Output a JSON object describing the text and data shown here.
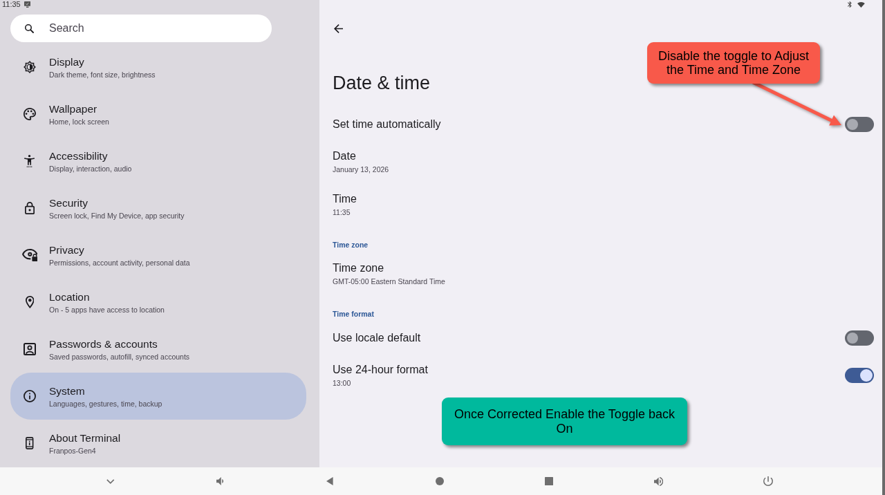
{
  "status_bar": {
    "time": "11:35"
  },
  "sidebar": {
    "search": {
      "placeholder": "Search"
    },
    "items": [
      {
        "title": "Display",
        "subtitle": "Dark theme, font size, brightness",
        "selected": false
      },
      {
        "title": "Wallpaper",
        "subtitle": "Home, lock screen",
        "selected": false
      },
      {
        "title": "Accessibility",
        "subtitle": "Display, interaction, audio",
        "selected": false
      },
      {
        "title": "Security",
        "subtitle": "Screen lock, Find My Device, app security",
        "selected": false
      },
      {
        "title": "Privacy",
        "subtitle": "Permissions, account activity, personal data",
        "selected": false
      },
      {
        "title": "Location",
        "subtitle": "On - 5 apps have access to location",
        "selected": false
      },
      {
        "title": "Passwords & accounts",
        "subtitle": "Saved passwords, autofill, synced accounts",
        "selected": false
      },
      {
        "title": "System",
        "subtitle": "Languages, gestures, time, backup",
        "selected": true
      },
      {
        "title": "About Terminal",
        "subtitle": "Franpos-Gen4",
        "selected": false
      }
    ]
  },
  "detail": {
    "title": "Date & time",
    "settings": [
      {
        "kind": "switch",
        "title": "Set time automatically",
        "on": false
      },
      {
        "kind": "item",
        "title": "Date",
        "summary": "January 13, 2026"
      },
      {
        "kind": "item",
        "title": "Time",
        "summary": "11:35"
      },
      {
        "kind": "header",
        "title": "Time zone"
      },
      {
        "kind": "item",
        "title": "Time zone",
        "summary": "GMT-05:00 Eastern Standard Time"
      },
      {
        "kind": "header",
        "title": "Time format"
      },
      {
        "kind": "switch",
        "title": "Use locale default",
        "on": false
      },
      {
        "kind": "switch",
        "title": "Use 24-hour format",
        "summary": "13:00",
        "on": true
      }
    ]
  },
  "annotations": [
    {
      "kind": "pointer",
      "text": "Disable the toggle to Adjust the Time and Time Zone",
      "color": "#f8594a"
    },
    {
      "kind": "note",
      "text": "Once Corrected Enable the Toggle back On",
      "color": "#00b99d"
    }
  ]
}
